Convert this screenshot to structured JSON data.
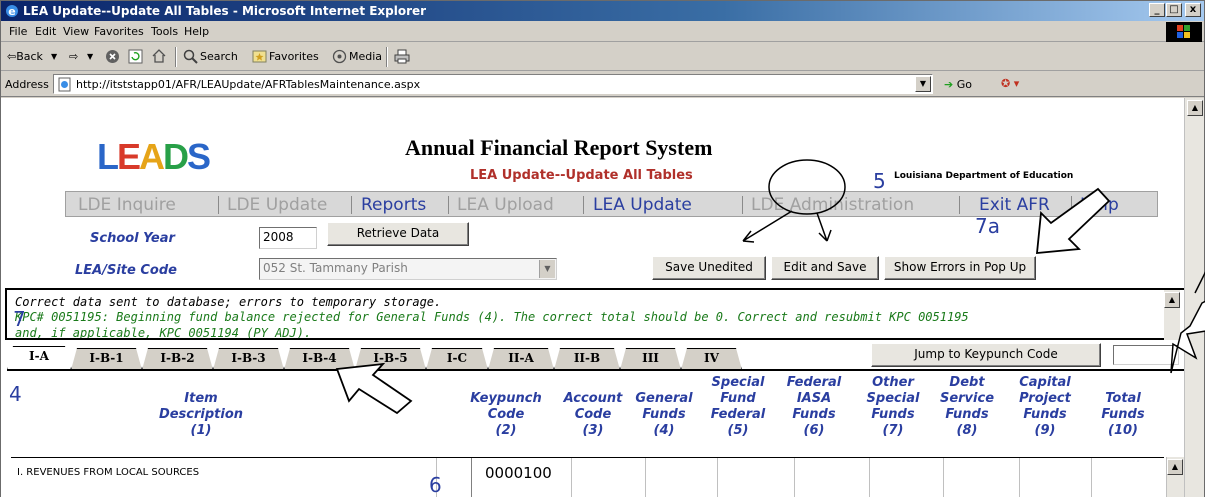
{
  "window": {
    "title": "LEA Update--Update All Tables - Microsoft Internet Explorer",
    "controls": [
      "_",
      "□",
      "x"
    ]
  },
  "menu": [
    "File",
    "Edit",
    "View",
    "Favorites",
    "Tools",
    "Help"
  ],
  "toolbar": {
    "back": "⇦Back",
    "forward": "⇨",
    "search": "Search",
    "favorites": "Favorites",
    "media": "Media"
  },
  "address": {
    "label": "Address",
    "url": "http://itststapp01/AFR/LEAUpdate/AFRTablesMaintenance.aspx",
    "go": "Go"
  },
  "page": {
    "logo": [
      "L",
      "E",
      "A",
      "D",
      "S"
    ],
    "title": "Annual Financial Report System",
    "subtitle": "LEA Update--Update All Tables",
    "dept": "Louisiana Department of Education",
    "nav": [
      "LDE Inquire",
      "LDE Update",
      "Reports",
      "LEA Upload",
      "LEA Update",
      "LDE Administration",
      "Exit AFR",
      "Help"
    ],
    "school_year_label": "School Year",
    "school_year_value": "2008",
    "retrieve_button": "Retrieve Data",
    "site_label": "LEA/Site Code",
    "site_value": "052 St. Tammany Parish",
    "save_unedited": "Save Unedited",
    "edit_save": "Edit and Save",
    "show_errors": "Show Errors in Pop Up",
    "message_line1": "Correct data sent to database; errors to temporary storage.",
    "message_line2": "KPC# 0051195: Beginning fund balance rejected for General Funds (4). The correct total should be 0. Correct and resubmit KPC 0051195",
    "message_line3": "and, if applicable, KPC 0051194 (PY ADJ).",
    "tabs": [
      "I-A",
      "I-B-1",
      "I-B-2",
      "I-B-3",
      "I-B-4",
      "I-B-5",
      "I-C",
      "II-A",
      "II-B",
      "III",
      "IV"
    ],
    "jump_button": "Jump to Keypunch Code",
    "columns": [
      {
        "l1": "",
        "l2": "Item",
        "l3": "Description",
        "l4": "(1)"
      },
      {
        "l1": "",
        "l2": "Keypunch",
        "l3": "Code",
        "l4": "(2)"
      },
      {
        "l1": "",
        "l2": "Account",
        "l3": "Code",
        "l4": "(3)"
      },
      {
        "l1": "",
        "l2": "General",
        "l3": "Funds",
        "l4": "(4)"
      },
      {
        "l1": "Special",
        "l2": "Fund",
        "l3": "Federal",
        "l4": "(5)"
      },
      {
        "l1": "Federal",
        "l2": "IASA",
        "l3": "Funds",
        "l4": "(6)"
      },
      {
        "l1": "Other",
        "l2": "Special",
        "l3": "Funds",
        "l4": "(7)"
      },
      {
        "l1": "Debt",
        "l2": "Service",
        "l3": "Funds",
        "l4": "(8)"
      },
      {
        "l1": "Capital",
        "l2": "Project",
        "l3": "Funds",
        "l4": "(9)"
      },
      {
        "l1": "",
        "l2": "Total",
        "l3": "Funds",
        "l4": "(10)"
      }
    ],
    "row1_desc": "I. REVENUES FROM LOCAL SOURCES",
    "row1_code": "0000100"
  },
  "annotations": [
    "5",
    "7a",
    "7",
    "4",
    "6"
  ],
  "colors": {
    "link_blue": "#2a3ea0",
    "subtitle_red": "#b0302a",
    "message_green": "#1a7a1a"
  }
}
